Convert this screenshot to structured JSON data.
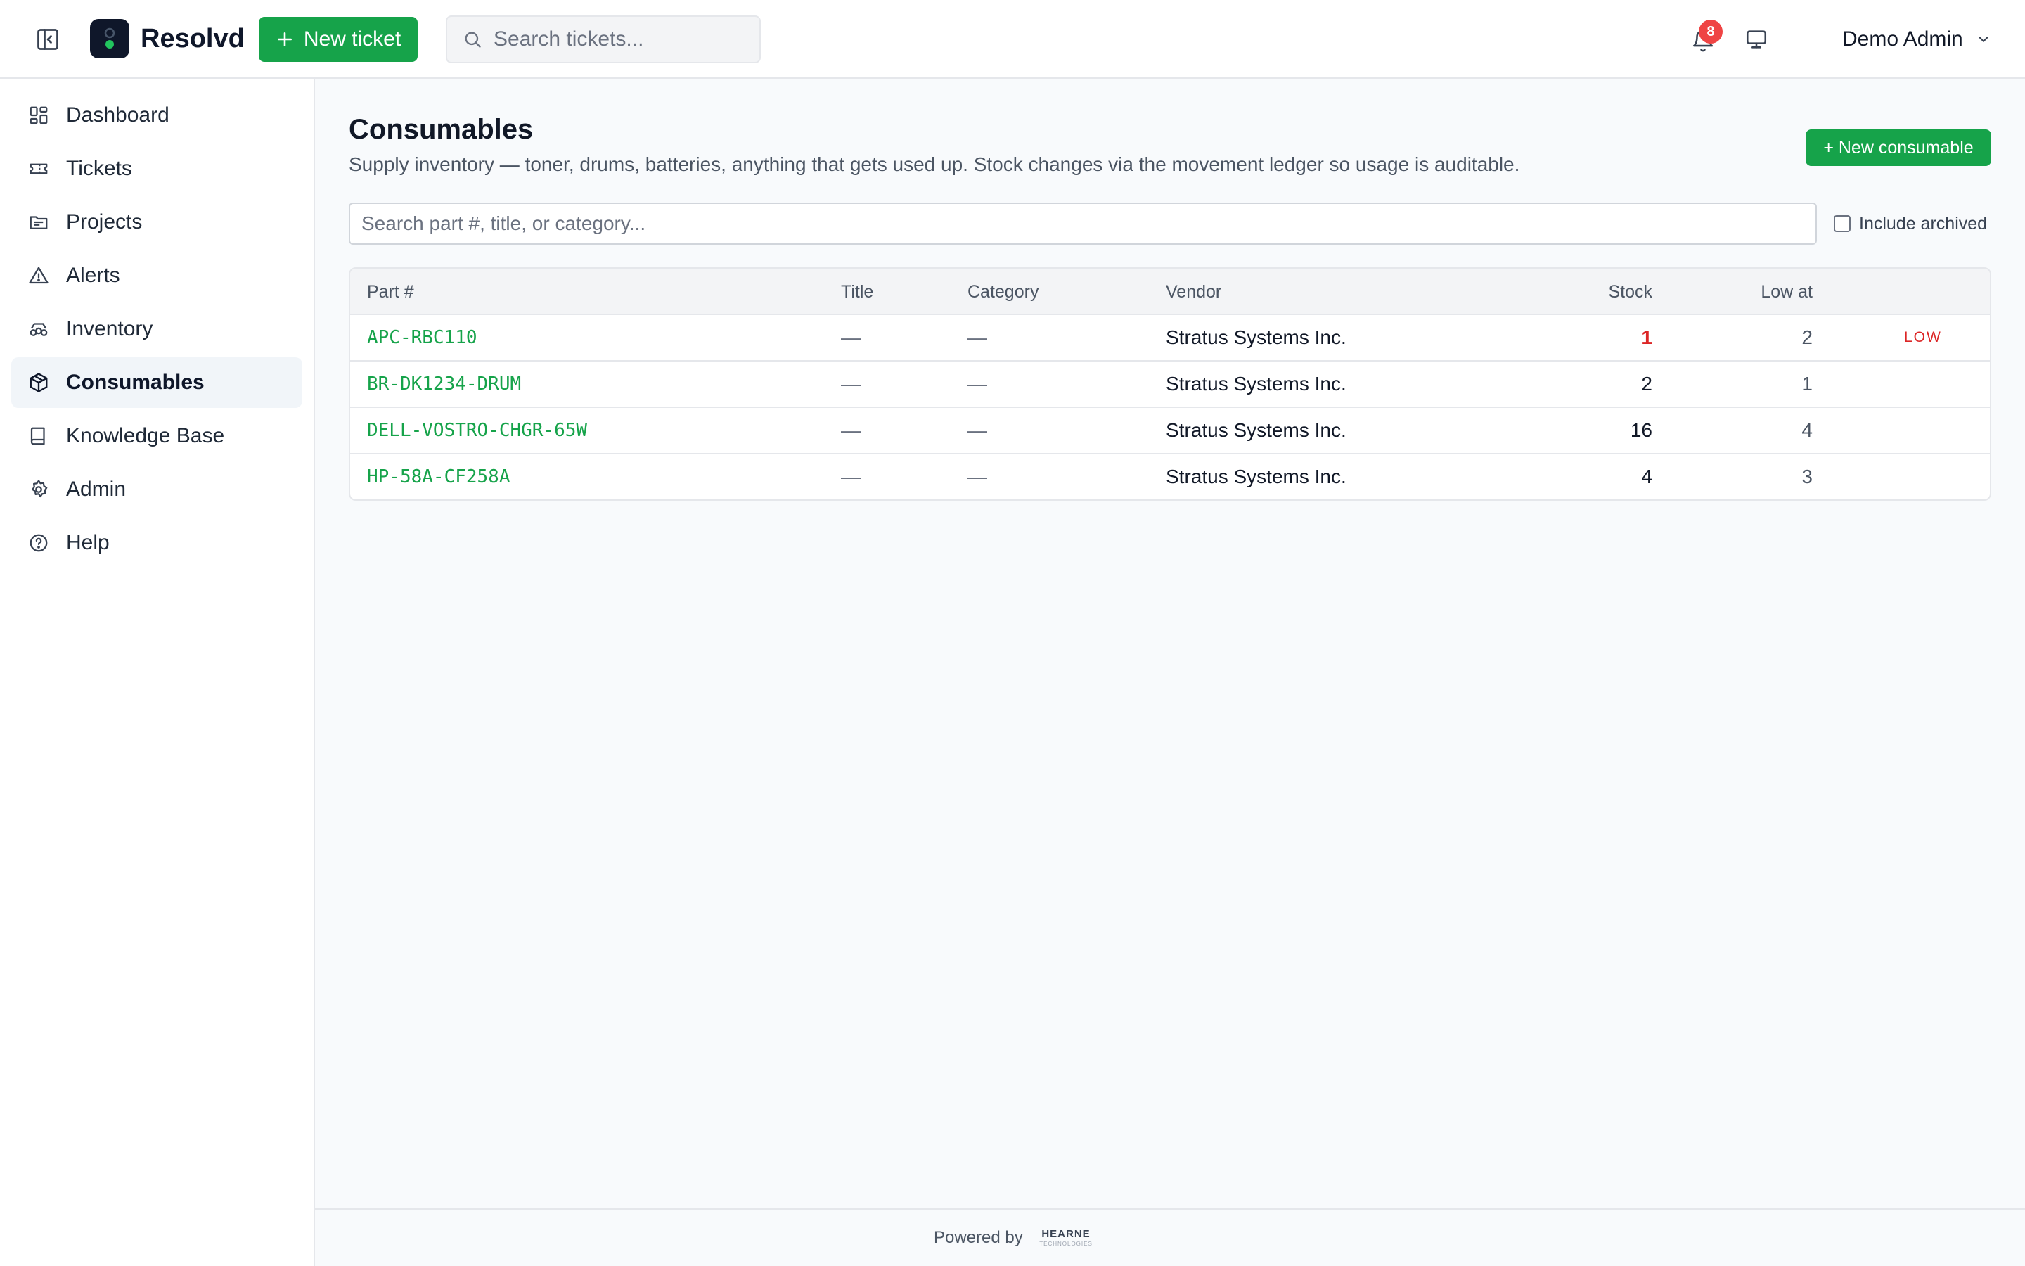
{
  "app": {
    "name": "Resolvd"
  },
  "header": {
    "new_ticket_label": "New ticket",
    "search_placeholder": "Search tickets...",
    "notification_count": "8",
    "user_name": "Demo Admin"
  },
  "sidebar": {
    "items": [
      {
        "label": "Dashboard",
        "icon": "dashboard-icon"
      },
      {
        "label": "Tickets",
        "icon": "ticket-icon"
      },
      {
        "label": "Projects",
        "icon": "projects-icon"
      },
      {
        "label": "Alerts",
        "icon": "alert-icon"
      },
      {
        "label": "Inventory",
        "icon": "inventory-icon"
      },
      {
        "label": "Consumables",
        "icon": "box-icon",
        "active": true
      },
      {
        "label": "Knowledge Base",
        "icon": "book-icon"
      },
      {
        "label": "Admin",
        "icon": "gear-icon"
      },
      {
        "label": "Help",
        "icon": "help-icon"
      }
    ]
  },
  "page": {
    "title": "Consumables",
    "subtitle": "Supply inventory — toner, drums, batteries, anything that gets used up. Stock changes via the movement ledger so usage is auditable.",
    "new_button": "+ New consumable",
    "filter_placeholder": "Search part #, title, or category...",
    "include_archived_label": "Include archived"
  },
  "table": {
    "columns": [
      "Part #",
      "Title",
      "Category",
      "Vendor",
      "Stock",
      "Low at"
    ],
    "rows": [
      {
        "part": "APC-RBC110",
        "title": "—",
        "category": "—",
        "vendor": "Stratus Systems Inc.",
        "stock": "1",
        "low_at": "2",
        "flag": "LOW"
      },
      {
        "part": "BR-DK1234-DRUM",
        "title": "—",
        "category": "—",
        "vendor": "Stratus Systems Inc.",
        "stock": "2",
        "low_at": "1",
        "flag": ""
      },
      {
        "part": "DELL-VOSTRO-CHGR-65W",
        "title": "—",
        "category": "—",
        "vendor": "Stratus Systems Inc.",
        "stock": "16",
        "low_at": "4",
        "flag": ""
      },
      {
        "part": "HP-58A-CF258A",
        "title": "—",
        "category": "—",
        "vendor": "Stratus Systems Inc.",
        "stock": "4",
        "low_at": "3",
        "flag": ""
      }
    ]
  },
  "footer": {
    "powered_by": "Powered by",
    "brand_name": "HEARNE",
    "brand_sub": "TECHNOLOGIES"
  },
  "colors": {
    "accent": "#16a34a",
    "danger": "#dc2626",
    "badge": "#ef4444"
  }
}
